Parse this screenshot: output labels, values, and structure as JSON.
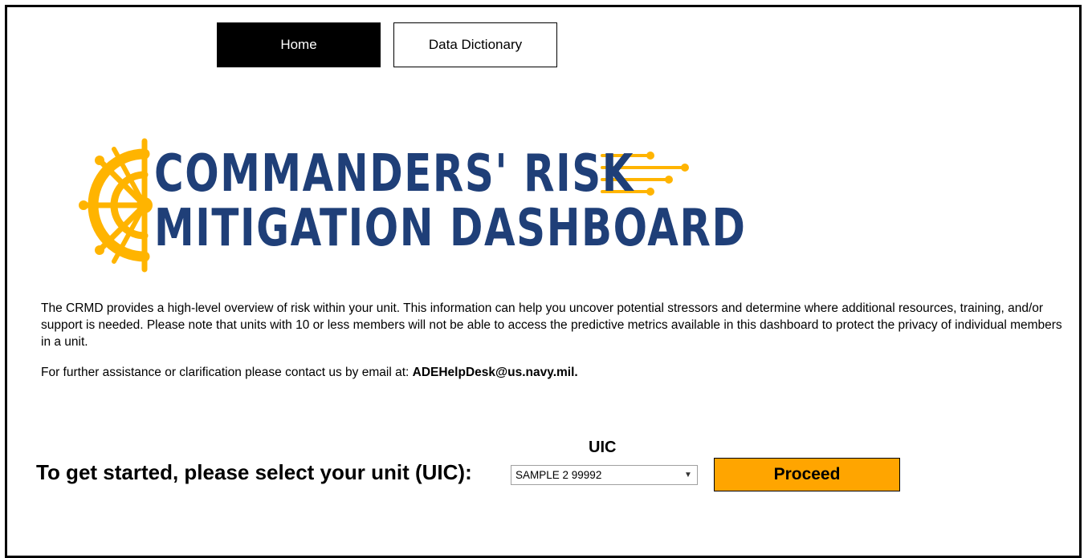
{
  "nav": {
    "home_label": "Home",
    "data_dictionary_label": "Data Dictionary"
  },
  "logo": {
    "line1": "COMMANDERS' RISK",
    "line2": "MITIGATION DASHBOARD",
    "text_color": "#1f3f78",
    "accent_color": "#ffb400"
  },
  "intro": {
    "paragraph": "The CRMD provides a high-level overview of risk within your unit. This information can help you uncover potential stressors and determine where additional resources, training, and/or support is needed. Please note that units with 10 or less members will not be able to access the predictive metrics available in this dashboard to protect the privacy of individual members in a unit.",
    "contact_prefix": "For further assistance or clarification please contact us by email at:",
    "contact_email": "ADEHelpDesk@us.navy.mil."
  },
  "selector": {
    "uic_label": "UIC",
    "prompt": "To get started, please select your unit (UIC):",
    "selected_value": "SAMPLE 2 99992",
    "dropdown_icon": "chevron-down-icon"
  },
  "proceed": {
    "label": "Proceed",
    "color": "#ffa500"
  }
}
